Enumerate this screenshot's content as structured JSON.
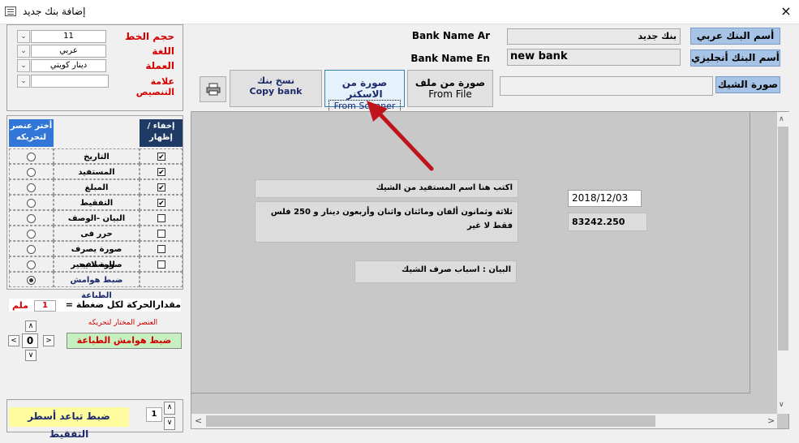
{
  "window": {
    "title": "إضافة بنك جديد",
    "close": "×"
  },
  "settings": {
    "font_size": {
      "label": "حجم الخط",
      "value": "11"
    },
    "language": {
      "label": "اللغة",
      "value": "عربي"
    },
    "currency": {
      "label": "العملة",
      "value": "دينار كويتي"
    },
    "custom_mark": {
      "label": "علامة التنصيص",
      "value": ""
    }
  },
  "bank": {
    "name_ar_label": "Bank Name Ar",
    "name_ar_value": "بنك جديد",
    "name_ar_button": "أسم البنك عربي",
    "name_en_label": "Bank Name En",
    "name_en_value": "new bank",
    "name_en_button": "أسم البنك أنجليزي",
    "check_image_label": "صورة الشيك",
    "check_image_value": ""
  },
  "toolbar": {
    "print_icon": "printer-icon",
    "copy_bank": {
      "line1": "نسخ بنك",
      "line2": "Copy bank"
    },
    "from_scanner": {
      "line1": "صورة من الاسكنر",
      "line2": "From Scanner"
    },
    "from_file": {
      "line1": "صورة من ملف",
      "line2": "From File"
    }
  },
  "elements_table": {
    "header_select": "أختر عنصر لتحريكه",
    "header_show": "إخفاء / إظهار",
    "rows": [
      {
        "label": "التاريخ",
        "checked": true,
        "selected": false
      },
      {
        "label": "المستفيد",
        "checked": true,
        "selected": false
      },
      {
        "label": "المبلغ",
        "checked": true,
        "selected": false
      },
      {
        "label": "التفقيط",
        "checked": true,
        "selected": false
      },
      {
        "label": "البيان -الوصف",
        "checked": false,
        "selected": false
      },
      {
        "label": "حرر فى",
        "checked": false,
        "selected": false
      },
      {
        "label": "صورة يصرف للمستفيد",
        "checked": false,
        "selected": false
      },
      {
        "label": "صورة لا يجير",
        "checked": false,
        "selected": false
      },
      {
        "label": "ضبط هوامش الطباعة",
        "checked": false,
        "selected": true
      }
    ]
  },
  "movement": {
    "label": "مقدارالحركة لكل ضغطة =",
    "value": "1",
    "unit": "ملم",
    "selected_element_label": "العنصر المختار لتحريكه",
    "selected_element_value": "ضبط هوامش الطباعة",
    "up": "∧",
    "down": "∨",
    "left": "<",
    "right": ">",
    "center": "0"
  },
  "spacing": {
    "label": "ضبط تباعد أسطر التفقيط",
    "value": "1",
    "up": "∧",
    "down": "∨"
  },
  "preview": {
    "beneficiary": "اكتب هنا اسم المستفيد من الشيك",
    "amount_words": "ثلاثة وثمانون ألفان ومائتان واثنان وأربعون دينار و 250 فلس فقط لا غير",
    "date": "2018/12/03",
    "amount": "83242.250",
    "description": "البيان : اسباب صرف الشيك"
  },
  "colors": {
    "accent_blue": "#a7c4e6",
    "label_red": "#d40000",
    "selected_header": "#3277d8",
    "navy_header": "#1f3a64",
    "arrow_red": "#c0141c"
  }
}
